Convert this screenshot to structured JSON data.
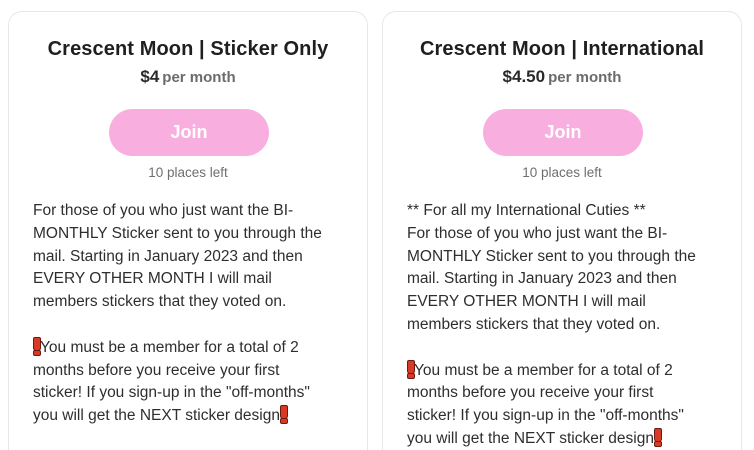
{
  "tiers": [
    {
      "title": "Crescent Moon | Sticker Only",
      "price": "$4",
      "period": "per month",
      "join_label": "Join",
      "places_left": "10 places left",
      "intro": "",
      "body": "For those of you who just want the BI-\nMONTHLY Sticker sent to you through the\nmail. Starting in January 2023 and then\nEVERY OTHER MONTH I will mail\nmembers stickers that they voted on.",
      "note": "You must be a member for a total of 2\nmonths before you receive your first\nsticker! If you sign-up in the \"off-months\"\nyou will get the NEXT sticker design"
    },
    {
      "title": "Crescent Moon | International",
      "price": "$4.50",
      "period": "per month",
      "join_label": "Join",
      "places_left": "10 places left",
      "intro": "** For all my International Cuties **",
      "body": "For those of you who just want the BI-\nMONTHLY Sticker sent to you through the\nmail. Starting in January 2023 and then\nEVERY OTHER MONTH I will mail\nmembers stickers that they voted on.",
      "note": "You must be a member for a total of 2\nmonths before you receive your first\nsticker! If you sign-up in the \"off-months\"\nyou will get the NEXT sticker design"
    }
  ],
  "colors": {
    "join_button": "#f9aee0",
    "exclamation": "#d93a25"
  },
  "icons": {
    "note_marker": "red-exclamation-icon"
  }
}
